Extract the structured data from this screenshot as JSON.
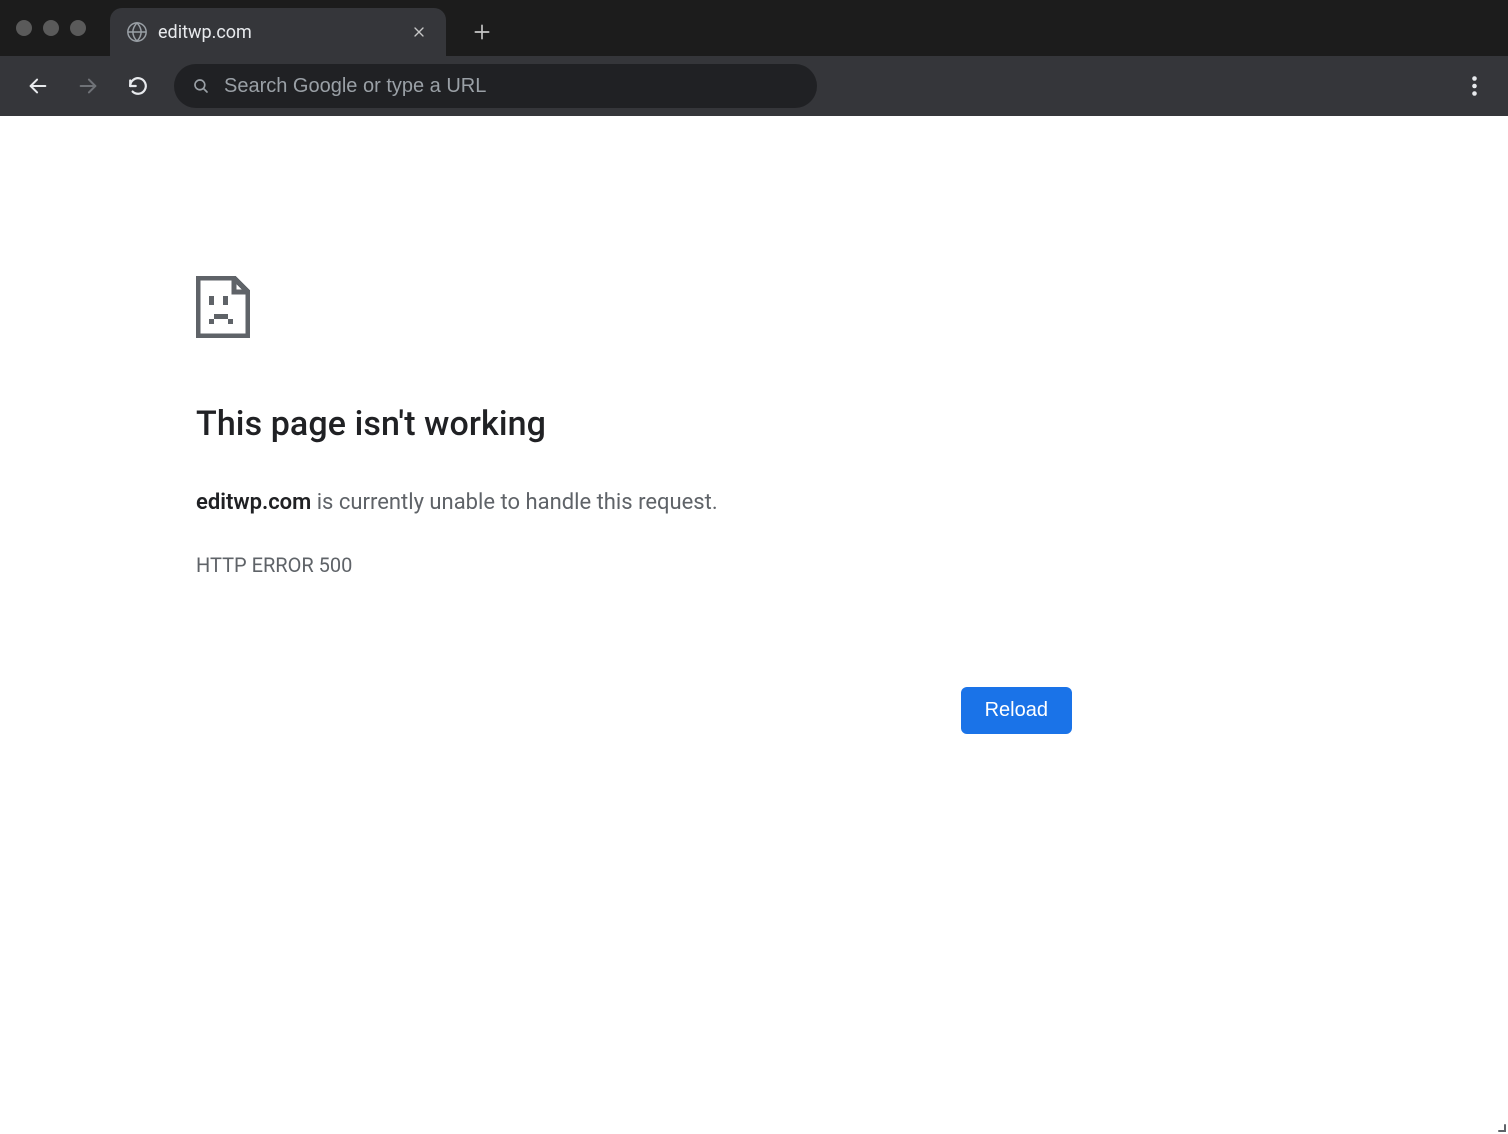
{
  "browser": {
    "tab": {
      "title": "editwp.com"
    },
    "omnibox": {
      "placeholder": "Search Google or type a URL",
      "value": ""
    }
  },
  "page": {
    "title": "This page isn't working",
    "host": "editwp.com",
    "message_suffix": " is currently unable to handle this request.",
    "error_code": "HTTP ERROR 500",
    "reload_label": "Reload"
  }
}
